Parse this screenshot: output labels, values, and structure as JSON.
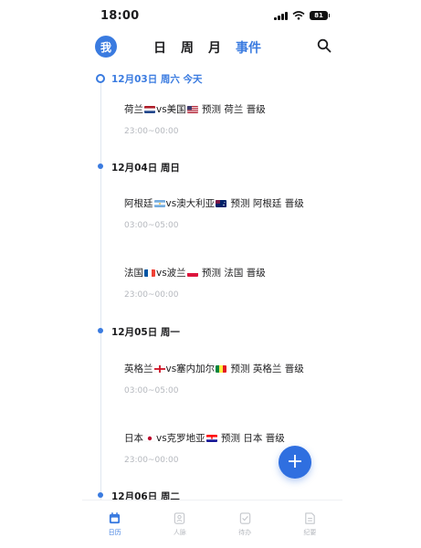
{
  "status": {
    "time": "18:00",
    "battery": "81"
  },
  "header": {
    "avatar": "我",
    "tabs": [
      {
        "label": "日"
      },
      {
        "label": "周"
      },
      {
        "label": "月"
      },
      {
        "label": "事件"
      }
    ]
  },
  "timeline": {
    "days": [
      {
        "label": "12月03日 周六 今天"
      },
      {
        "label": "12月04日 周日"
      },
      {
        "label": "12月05日 周一"
      },
      {
        "label": "12月06日 周二"
      }
    ],
    "events": [
      {
        "left": "荷兰",
        "mid": "vs美国",
        "tail": " 预测 荷兰 晋级",
        "time": "23:00~00:00"
      },
      {
        "left": "阿根廷",
        "mid": "vs澳大利亚",
        "tail": " 预测 阿根廷 晋级",
        "time": "03:00~05:00"
      },
      {
        "left": "法国",
        "mid": "vs波兰",
        "tail": "  预测 法国 晋级",
        "time": "23:00~00:00"
      },
      {
        "left": "英格兰",
        "mid": "vs塞内加尔",
        "tail": " 预测 英格兰 晋级",
        "time": "03:00~05:00"
      },
      {
        "left": "日本",
        "mid": "vs克罗地亚",
        "tail": " 预测 日本 晋级",
        "time": "23:00~00:00"
      }
    ]
  },
  "fab": {
    "label": "+"
  },
  "bottom_nav": [
    {
      "label": "日历"
    },
    {
      "label": "人脉"
    },
    {
      "label": "待办"
    },
    {
      "label": "纪要"
    }
  ],
  "colors": {
    "accent": "#3a7be0"
  }
}
